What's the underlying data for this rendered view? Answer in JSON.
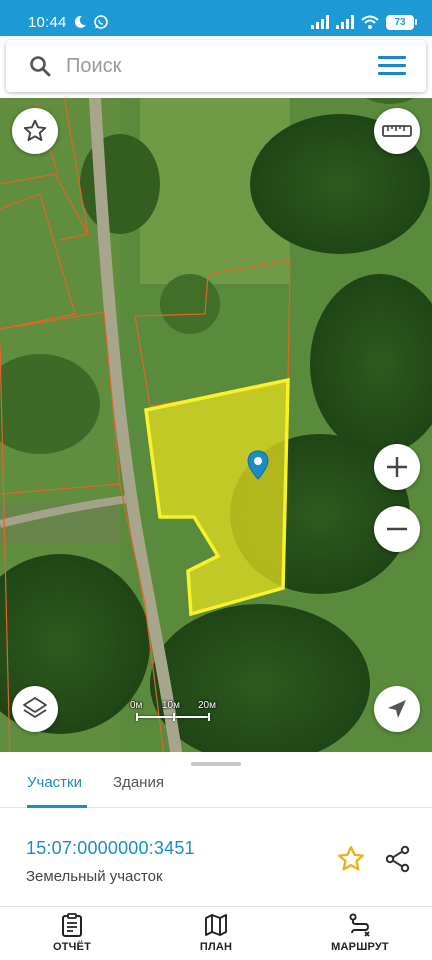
{
  "status_bar": {
    "time": "10:44",
    "battery": "73",
    "icons": [
      "moon-icon",
      "whatsapp-icon",
      "signal-icon",
      "signal-icon",
      "wifi-icon",
      "battery-icon"
    ]
  },
  "search": {
    "placeholder": "Поиск",
    "search_icon": "search-icon",
    "menu_icon": "menu-icon"
  },
  "map": {
    "favorite_icon": "star-outline-icon",
    "ruler_icon": "ruler-icon",
    "zoom_in_icon": "plus-icon",
    "zoom_out_icon": "minus-icon",
    "layers_icon": "layers-icon",
    "location_icon": "navigation-arrow-icon",
    "marker_icon": "map-pin-icon",
    "selected_parcel_color": "#f4ee22",
    "parcel_border_color": "#e0662a",
    "scale": {
      "labels": [
        "0м",
        "10м",
        "20м"
      ]
    }
  },
  "panel": {
    "tabs": [
      {
        "label": "Участки",
        "active": true
      },
      {
        "label": "Здания",
        "active": false
      }
    ],
    "parcel": {
      "cadastral_number": "15:07:0000000:3451",
      "type": "Земельный участок"
    },
    "favorite_icon": "star-icon",
    "share_icon": "share-icon"
  },
  "bottom_nav": [
    {
      "label": "ОТЧЁТ",
      "icon": "clipboard-icon"
    },
    {
      "label": "ПЛАН",
      "icon": "map-icon"
    },
    {
      "label": "МАРШРУТ",
      "icon": "route-icon"
    }
  ],
  "colors": {
    "status_bar": "#1d9ad6",
    "accent": "#1d8bc8",
    "star": "#e7b417"
  }
}
